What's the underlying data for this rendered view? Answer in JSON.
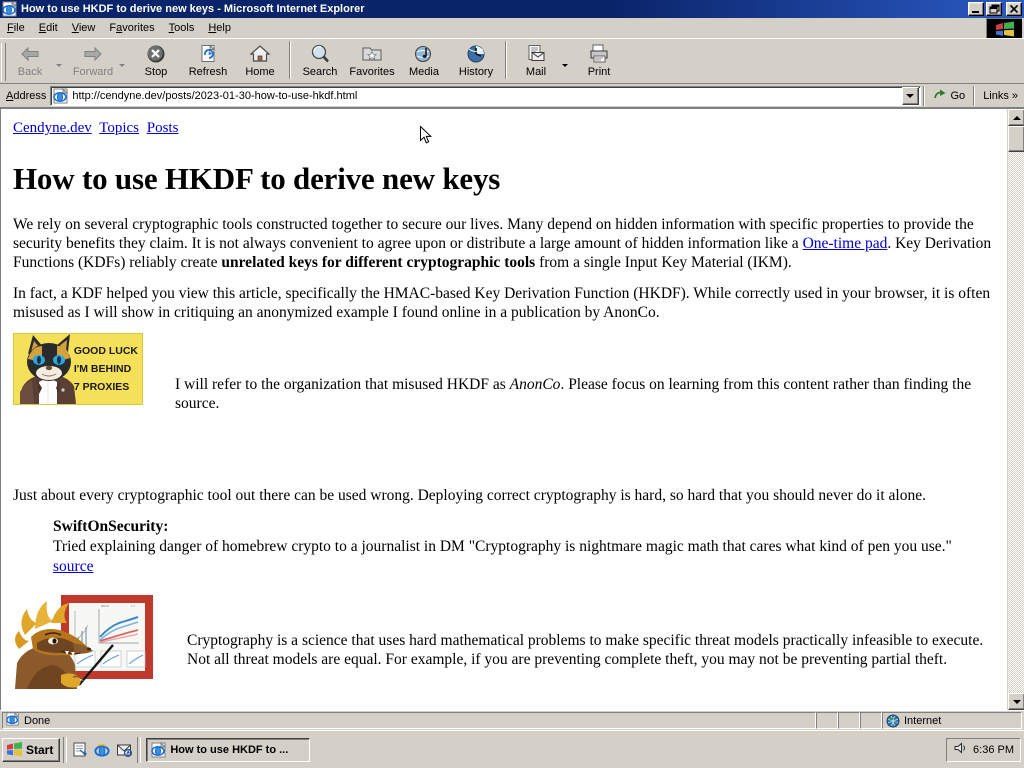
{
  "window": {
    "title": "How to use HKDF to derive new keys - Microsoft Internet Explorer",
    "icon": "ie-document-icon",
    "buttons": {
      "minimize": "minimize-button",
      "restore": "restore-button",
      "close": "close-button"
    }
  },
  "menu": {
    "items": [
      {
        "label": "File",
        "accel": "F"
      },
      {
        "label": "Edit",
        "accel": "E"
      },
      {
        "label": "View",
        "accel": "V"
      },
      {
        "label": "Favorites",
        "accel": "a"
      },
      {
        "label": "Tools",
        "accel": "T"
      },
      {
        "label": "Help",
        "accel": "H"
      }
    ],
    "logo": "windows-flag-logo"
  },
  "toolbar": {
    "buttons": [
      {
        "label": "Back",
        "icon": "back-arrow-icon",
        "disabled": true,
        "dropdown": true
      },
      {
        "label": "Forward",
        "icon": "forward-arrow-icon",
        "disabled": true,
        "dropdown": true
      },
      {
        "label": "Stop",
        "icon": "stop-icon",
        "disabled": false,
        "dropdown": false
      },
      {
        "label": "Refresh",
        "icon": "refresh-icon",
        "disabled": false,
        "dropdown": false
      },
      {
        "label": "Home",
        "icon": "home-icon",
        "disabled": false,
        "dropdown": false
      },
      {
        "label": "Search",
        "icon": "search-icon",
        "disabled": false,
        "dropdown": false
      },
      {
        "label": "Favorites",
        "icon": "favorites-folder-icon",
        "disabled": false,
        "dropdown": false
      },
      {
        "label": "Media",
        "icon": "media-icon",
        "disabled": false,
        "dropdown": false
      },
      {
        "label": "History",
        "icon": "history-icon",
        "disabled": false,
        "dropdown": false
      },
      {
        "label": "Mail",
        "icon": "mail-icon",
        "disabled": false,
        "dropdown": true
      },
      {
        "label": "Print",
        "icon": "print-icon",
        "disabled": false,
        "dropdown": false
      }
    ]
  },
  "address": {
    "label": "Address",
    "icon": "ie-page-icon",
    "url": "http://cendyne.dev/posts/2023-01-30-how-to-use-hkdf.html",
    "go_label": "Go",
    "links_label": "Links"
  },
  "page": {
    "nav": [
      {
        "label": "Cendyne.dev"
      },
      {
        "label": "Topics"
      },
      {
        "label": "Posts"
      }
    ],
    "title": "How to use HKDF to derive new keys",
    "p1": {
      "a": "We rely on several cryptographic tools constructed together to secure our lives. Many depend on hidden information with specific properties to provide the security benefits they claim. It is not always convenient to agree upon or distribute a large amount of hidden information like a ",
      "link": "One-time pad",
      "b": ". Key Derivation Functions (KDFs) reliably create ",
      "bold": "unrelated keys for different cryptographic tools",
      "c": " from a single Input Key Material (IKM)."
    },
    "p2": "In fact, a KDF helped you view this article, specifically the HMAC-based Key Derivation Function (HKDF). While correctly used in your browser, it is often misused as I will show in critiquing an anonymized example I found online in a publication by AnonCo.",
    "figure1": {
      "image_name": "good-luck-7-proxies-meme",
      "image_lines": [
        "GOOD LUCK",
        "I'M BEHIND",
        "7 PROXIES"
      ],
      "caption_a": "I will refer to the organization that misused HKDF as ",
      "caption_em": "AnonCo",
      "caption_b": ". Please focus on learning from this content rather than finding the source."
    },
    "p3": "Just about every cryptographic tool out there can be used wrong. Deploying correct cryptography is hard, so hard that you should never do it alone.",
    "quote": {
      "who": "SwiftOnSecurity:",
      "text": "Tried explaining danger of homebrew crypto to a journalist in DM \"Cryptography is nightmare magic math that cares what kind of pen you use.\"",
      "source_label": "source"
    },
    "figure2": {
      "image_name": "dragon-presenting-charts-illustration",
      "caption": "Cryptography is a science that uses hard mathematical problems to make specific threat models practically infeasible to execute. Not all threat models are equal. For example, if you are preventing complete theft, you may not be preventing partial theft."
    }
  },
  "scrollbar": {
    "up": "scroll-up-button",
    "down": "scroll-down-button",
    "thumb": "scroll-thumb"
  },
  "statusbar": {
    "status": "Done",
    "zone": "Internet",
    "zone_icon": "globe-icon"
  },
  "taskbar": {
    "start_label": "Start",
    "quicklaunch": [
      "show-desktop-icon",
      "internet-explorer-icon",
      "outlook-express-icon"
    ],
    "task": {
      "label": "How to use HKDF to ...",
      "icon": "ie-document-icon"
    },
    "clock": "6:36 PM",
    "tray_icons": [
      "volume-icon"
    ]
  },
  "colors": {
    "titlebar": "#0a246a",
    "chrome": "#d4d0c8",
    "link": "#0000cc",
    "meme_bg": "#f5e05a",
    "taskbar": "#d4d0c8"
  }
}
